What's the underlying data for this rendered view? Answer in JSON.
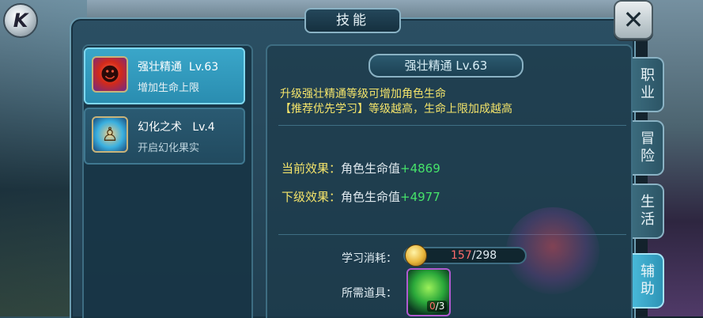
{
  "header": {
    "title": "技能"
  },
  "skills": [
    {
      "name": "强壮精通",
      "level": "Lv.63",
      "desc": "增加生命上限",
      "icon": "red-demon-icon",
      "active": true
    },
    {
      "name": "幻化之术",
      "level": "Lv.4",
      "desc": "开启幻化果实",
      "icon": "mage-transform-icon",
      "active": false
    }
  ],
  "detail": {
    "title": "强壮精通 Lv.63",
    "desc_line1": "升级强壮精通等级可增加角色生命",
    "desc_line2": "【推荐优先学习】等级越高，生命上限加成越高",
    "current_label": "当前效果：",
    "current_text": "角色生命值",
    "current_value": "+4869",
    "next_label": "下级效果：",
    "next_text": "角色生命值",
    "next_value": "+4977",
    "cost_label": "学习消耗：",
    "cost_current": "157",
    "cost_separator": "/",
    "cost_max": "298",
    "item_label": "所需道具：",
    "item_have": "0",
    "item_separator": "/",
    "item_need": "3"
  },
  "tabs": [
    {
      "line1": "职",
      "line2": "业",
      "active": false
    },
    {
      "line1": "冒",
      "line2": "险",
      "active": false
    },
    {
      "line1": "生",
      "line2": "活",
      "active": false
    },
    {
      "line1": "辅",
      "line2": "助",
      "active": true
    }
  ],
  "logo_text": "K",
  "close_glyph": "✕",
  "colors": {
    "accent": "#3aa6c9",
    "highlight_text": "#f4e46a",
    "bonus": "#46e36a",
    "deficit": "#ff6b6b"
  }
}
